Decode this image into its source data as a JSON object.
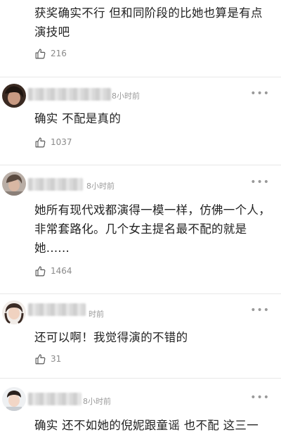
{
  "comments": [
    {
      "time": "",
      "text": "获奖确实不行 但和同阶段的比她也算是有点演技吧",
      "likes": "216",
      "more_icon": "more-dots-icon"
    },
    {
      "time": "8小时前",
      "text": "确实 不配是真的",
      "likes": "1037",
      "more_icon": "more-dots-icon"
    },
    {
      "time": "8小时前",
      "text": "她所有现代戏都演得一模一样，仿佛一个人，非常套路化。几个女主提名最不配的就是她......",
      "likes": "1464",
      "more_icon": "more-dots-icon"
    },
    {
      "time": "时前",
      "text": "还可以啊！我觉得演的不错的",
      "likes": "31",
      "more_icon": "more-dots-icon"
    },
    {
      "time": "8小时前",
      "text": "确实  还不如她的倪妮跟童谣 也不配 这三一",
      "likes": "",
      "more_icon": "more-dots-icon"
    }
  ],
  "ui": {
    "more_label": "•••",
    "like_icon": "thumbs-up-icon",
    "text_color": "#222222",
    "meta_color": "#9a9a9a",
    "divider_color": "#e8e8e8"
  }
}
